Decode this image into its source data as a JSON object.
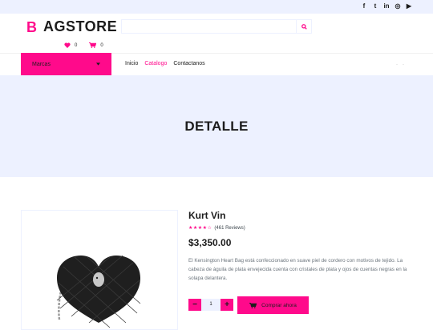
{
  "topbar": {
    "social": [
      {
        "icon": "facebook-icon",
        "glyph": "f"
      },
      {
        "icon": "twitter-icon",
        "glyph": "t"
      },
      {
        "icon": "linkedin-icon",
        "glyph": "in"
      },
      {
        "icon": "instagram-icon",
        "glyph": "◎"
      },
      {
        "icon": "youtube-icon",
        "glyph": "▶"
      }
    ]
  },
  "header": {
    "logo_letter": "B",
    "logo_text": "AGSTORE",
    "search_placeholder": "",
    "wishlist_count": "0",
    "cart_count": "0"
  },
  "nav": {
    "brands_label": "Marcas",
    "items": [
      "Inicio",
      "Catalogo",
      "Contactanos"
    ],
    "active": "Catalogo"
  },
  "hero": {
    "title": "DETALLE"
  },
  "product": {
    "name": "Kurt Vin",
    "stars": "★★★★☆",
    "reviews": "(461 Reviews)",
    "price": "$3,350.00",
    "description": "El Kensington Heart Bag está confeccionado en suave piel de cordero con motivos de tejido. La cabeza de águila de plata envejecida cuenta con cristales de plata y ojos de cuentas negras en la solapa delantera.",
    "quantity": "1",
    "add_to_cart_label": "Comprar ahora"
  },
  "colors": {
    "accent": "#ff0a8b",
    "light": "#edf1ff",
    "dark": "#1c1c1c"
  }
}
